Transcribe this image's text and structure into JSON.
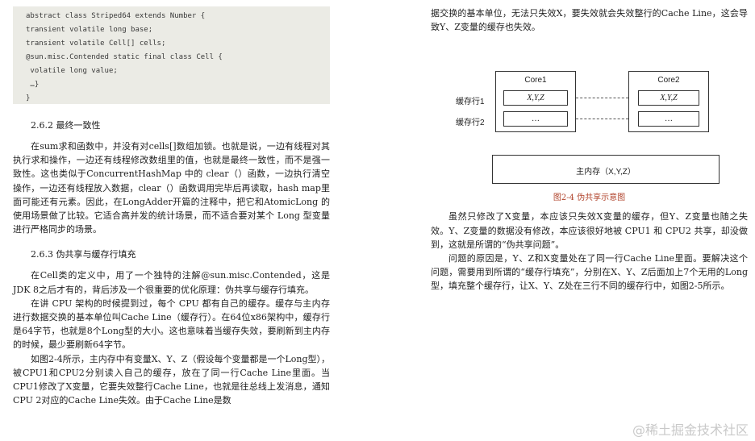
{
  "code_lines": [
    "abstract class Striped64 extends Number {",
    "transient volatile long base;",
    "transient volatile Cell[] cells;",
    "@sun.misc.Contended static final class Cell {",
    " volatile long value;",
    " …}",
    "}"
  ],
  "section_262": {
    "title": "2.6.2 最终一致性",
    "para1": "在sum求和函数中，并没有对cells[]数组加锁。也就是说，一边有线程对其执行求和操作，一边还有线程修改数组里的值，也就是最终一致性，而不是强一致性。这也类似于ConcurrentHashMap 中的 clear（）函数，一边执行清空操作，一边还有线程放入数据，clear（）函数调用完毕后再读取，hash map里面可能还有元素。因此，在LongAdder开篇的注释中，把它和AtomicLong 的使用场景做了比较。它适合高并发的统计场景，而不适合要对某个 Long 型变量进行严格同步的场景。"
  },
  "section_263": {
    "title": "2.6.3 伪共享与缓存行填充",
    "para1": "在Cell类的定义中，用了一个独特的注解@sun.misc.Contended，这是JDK 8之后才有的，背后涉及一个很重要的优化原理：伪共享与缓存行填充。",
    "para2": "在讲 CPU 架构的时候提到过，每个 CPU 都有自己的缓存。缓存与主内存进行数据交换的基本单位叫Cache Line（缓存行）。在64位x86架构中，缓存行是64字节，也就是8个Long型的大小。这也意味着当缓存失效，要刷新到主内存的时候，最少要刷新64字节。",
    "para3": "如图2-4所示，主内存中有变量X、Y、Z（假设每个变量都是一个Long型），被CPU1和CPU2分别读入自己的缓存，放在了同一行Cache Line里面。当CPU1修改了X变量，它要失效整行Cache Line，也就是往总线上发消息，通知CPU 2对应的Cache Line失效。由于Cache Line是数"
  },
  "right": {
    "para_cont": "据交换的基本单位，无法只失效X，要失效就会失效整行的Cache Line，这会导致Y、Z变量的缓存也失效。",
    "para2": "虽然只修改了X变量，本应该只失效X变量的缓存，但Y、Z变量也随之失效。Y、Z变量的数据没有修改，本应该很好地被 CPU1 和 CPU2 共享，却没做到，这就是所谓的“伪共享问题”。",
    "para3": "问题的原因是，Y、Z和X变量处在了同一行Cache Line里面。要解决这个问题，需要用到所谓的“缓存行填充”，分别在X、Y、Z后面加上7个无用的Long型，填充整个缓存行，让X、Y、Z处在三行不同的缓存行中，如图2-5所示。"
  },
  "diagram": {
    "core1": "Core1",
    "core2": "Core2",
    "row1_label": "缓存行1",
    "row2_label": "缓存行2",
    "cell_xyz": "X,Y,Z",
    "cell_dots": "…",
    "main_memory": "主内存（X,Y,Z）",
    "caption": "图2-4 伪共享示意图"
  },
  "watermark": "@稀土掘金技术社区",
  "colors": {
    "code_bg": "#ebebe5",
    "caption": "#b0432b"
  }
}
